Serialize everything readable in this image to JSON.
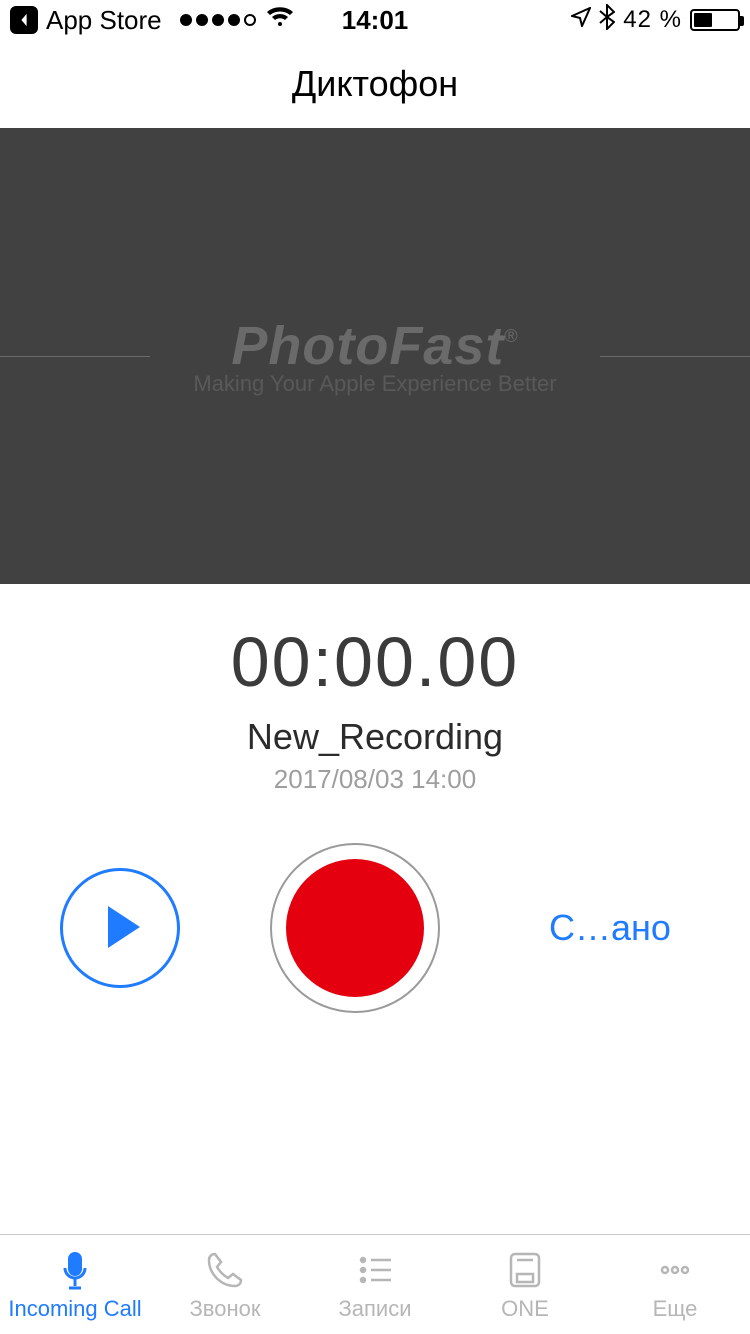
{
  "status_bar": {
    "back_label": "App Store",
    "time": "14:01",
    "battery_pct": "42 %"
  },
  "nav": {
    "title": "Диктофон"
  },
  "brand": {
    "name": "PhotoFast",
    "reg": "®",
    "tagline": "Making Your Apple Experience Better"
  },
  "recorder": {
    "timer": "00:00.00",
    "name": "New_Recording",
    "date": "2017/08/03 14:00",
    "done_label": "С…ано"
  },
  "tabs": {
    "incoming": "Incoming Call",
    "call": "Звонок",
    "records": "Записи",
    "one": "ONE",
    "more": "Еще"
  }
}
